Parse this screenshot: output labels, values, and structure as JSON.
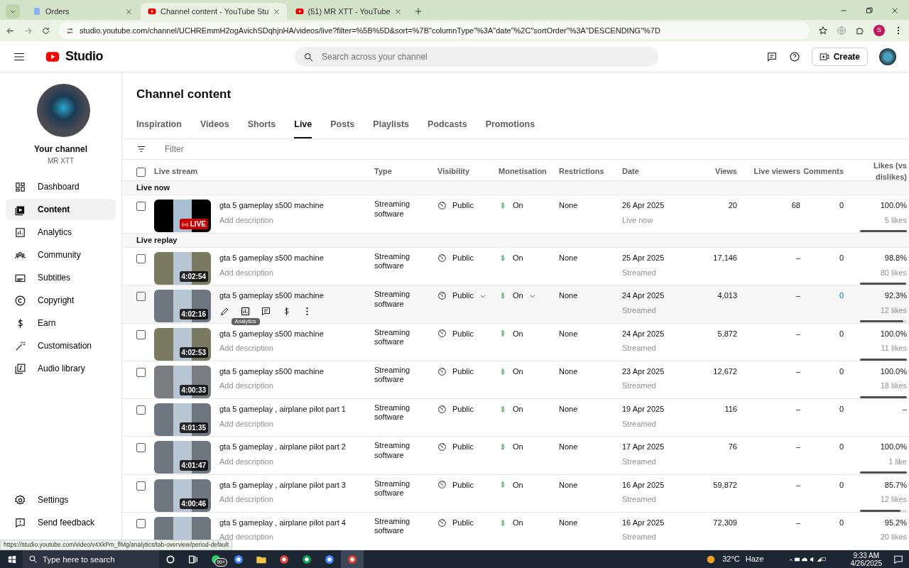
{
  "browser": {
    "tabs": [
      {
        "label": "Orders",
        "selected": false,
        "kind": "doc"
      },
      {
        "label": "Channel content - YouTube Stu",
        "selected": true,
        "kind": "yt"
      },
      {
        "label": "(51) MR XTT - YouTube",
        "selected": false,
        "kind": "yt"
      }
    ],
    "url": "studio.youtube.com/channel/UCHREmmH2ogAvichSDqhjnHA/videos/live?filter=%5B%5D&sort=%7B\"columnType\"%3A\"date\"%2C\"sortOrder\"%3A\"DESCENDING\"%7D",
    "profile_initial": "S"
  },
  "header": {
    "logo": "Studio",
    "search": {
      "placeholder": "Search across your channel"
    },
    "create": "Create"
  },
  "sidebar": {
    "channel_title": "Your channel",
    "channel_name": "MR XTT",
    "items": [
      {
        "label": "Dashboard",
        "selected": false
      },
      {
        "label": "Content",
        "selected": true
      },
      {
        "label": "Analytics",
        "selected": false
      },
      {
        "label": "Community",
        "selected": false
      },
      {
        "label": "Subtitles",
        "selected": false
      },
      {
        "label": "Copyright",
        "selected": false
      },
      {
        "label": "Earn",
        "selected": false
      },
      {
        "label": "Customisation",
        "selected": false
      },
      {
        "label": "Audio library",
        "selected": false
      }
    ],
    "bottom_items": [
      {
        "label": "Settings"
      },
      {
        "label": "Send feedback"
      }
    ]
  },
  "page_title": "Channel content",
  "tabs": [
    {
      "label": "Inspiration",
      "selected": false
    },
    {
      "label": "Videos",
      "selected": false
    },
    {
      "label": "Shorts",
      "selected": false
    },
    {
      "label": "Live",
      "selected": true
    },
    {
      "label": "Posts",
      "selected": false
    },
    {
      "label": "Playlists",
      "selected": false
    },
    {
      "label": "Podcasts",
      "selected": false
    },
    {
      "label": "Promotions",
      "selected": false
    }
  ],
  "filter": {
    "placeholder": "Filter"
  },
  "table": {
    "select_all_checked": false,
    "columns": [
      "Live stream",
      "Type",
      "Visibility",
      "Monetisation",
      "Restrictions",
      "Date",
      "Views",
      "Live viewers",
      "Comments",
      "Likes (vs dislikes)"
    ],
    "sections": [
      {
        "title": "Live now",
        "rows": [
          {
            "kind": "live",
            "badge": "LIVE",
            "title": "gta 5 gameplay s500 machine",
            "description": "Add description",
            "type": "Streaming software",
            "visibility": "Public",
            "monetisation": "On",
            "restrictions": "None",
            "date": "26 Apr 2025",
            "date_status": "Live now",
            "views": "20",
            "live_viewers": "68",
            "comments": "0",
            "likes_pct": "100.0%",
            "likes_count": "5 likes",
            "level": 1,
            "hovered": false,
            "checked": false
          }
        ]
      },
      {
        "title": "Live replay",
        "rows": [
          {
            "kind": "replay",
            "badge": "4:02:54",
            "title": "gta 5 gameplay s500 machine",
            "description": "Add description",
            "type": "Streaming software",
            "visibility": "Public",
            "monetisation": "On",
            "restrictions": "None",
            "date": "25 Apr 2025",
            "date_status": "Streamed",
            "views": "17,146",
            "live_viewers": "–",
            "comments": "0",
            "likes_pct": "98.8%",
            "likes_count": "80 likes",
            "level": 0.988,
            "hovered": false,
            "checked": false
          },
          {
            "kind": "replay",
            "badge": "4:02:16",
            "title": "gta 5 gameplay s500 machine",
            "type": "Streaming software",
            "visibility": "Public",
            "monetisation": "On",
            "restrictions": "None",
            "date": "24 Apr 2025",
            "date_status": "Streamed",
            "views": "4,013",
            "live_viewers": "–",
            "comments": "0",
            "likes_pct": "92.3%",
            "likes_count": "12 likes",
            "level": 0.923,
            "hovered": true,
            "tooltip": "Analytics",
            "checked": false
          },
          {
            "kind": "replay",
            "badge": "4:02:53",
            "title": "gta 5 gameplay s500 machine",
            "description": "Add description",
            "type": "Streaming software",
            "visibility": "Public",
            "monetisation": "On",
            "restrictions": "None",
            "date": "24 Apr 2025",
            "date_status": "Streamed",
            "views": "5,872",
            "live_viewers": "–",
            "comments": "0",
            "likes_pct": "100.0%",
            "likes_count": "11 likes",
            "level": 1,
            "hovered": false,
            "checked": false
          },
          {
            "kind": "replay",
            "badge": "4:00:33",
            "title": "gta 5 gameplay s500 machine",
            "description": "Add description",
            "type": "Streaming software",
            "visibility": "Public",
            "monetisation": "On",
            "restrictions": "None",
            "date": "23 Apr 2025",
            "date_status": "Streamed",
            "views": "12,672",
            "live_viewers": "–",
            "comments": "0",
            "likes_pct": "100.0%",
            "likes_count": "18 likes",
            "level": 1,
            "hovered": false,
            "checked": false
          },
          {
            "kind": "replay",
            "badge": "4:01:35",
            "title": "gta 5 gameplay , airplane pilot part 1",
            "description": "Add description",
            "type": "Streaming software",
            "visibility": "Public",
            "monetisation": "On",
            "restrictions": "None",
            "date": "19 Apr 2025",
            "date_status": "Streamed",
            "views": "116",
            "live_viewers": "–",
            "comments": "0",
            "likes_pct": "–",
            "hovered": false,
            "checked": false
          },
          {
            "kind": "replay",
            "badge": "4:01:47",
            "title": "gta 5 gameplay , airplane pilot part 2",
            "description": "Add description",
            "type": "Streaming software",
            "visibility": "Public",
            "monetisation": "On",
            "restrictions": "None",
            "date": "17 Apr 2025",
            "date_status": "Streamed",
            "views": "76",
            "live_viewers": "–",
            "comments": "0",
            "likes_pct": "100.0%",
            "likes_count": "1 like",
            "level": 1,
            "hovered": false,
            "checked": false
          },
          {
            "kind": "replay",
            "badge": "4:00:46",
            "title": "gta 5 gameplay , airplane pilot part 3",
            "description": "Add description",
            "type": "Streaming software",
            "visibility": "Public",
            "monetisation": "On",
            "restrictions": "None",
            "date": "16 Apr 2025",
            "date_status": "Streamed",
            "views": "59,872",
            "live_viewers": "–",
            "comments": "0",
            "likes_pct": "85.7%",
            "likes_count": "12 likes",
            "level": 0.857,
            "hovered": false,
            "checked": false
          },
          {
            "kind": "replay",
            "title": "gta 5 gameplay , airplane pilot part 4",
            "description": "Add description",
            "type": "Streaming software",
            "visibility": "Public",
            "monetisation": "On",
            "restrictions": "None",
            "date": "16 Apr 2025",
            "date_status": "Streamed",
            "views": "72,309",
            "live_viewers": "–",
            "comments": "0",
            "likes_pct": "95.2%",
            "likes_count": "20 likes",
            "hovered": false,
            "checked": false
          }
        ]
      }
    ]
  },
  "status_url": "https://studio.youtube.com/video/v4XkPm_flMg/analytics/tab-overview/period-default",
  "taskbar": {
    "search": {
      "placeholder": "Type here to search"
    },
    "badge": "99+",
    "temperature": "32°C",
    "weather": "Haze",
    "time": "9:33 AM",
    "date": "4/26/2025"
  }
}
